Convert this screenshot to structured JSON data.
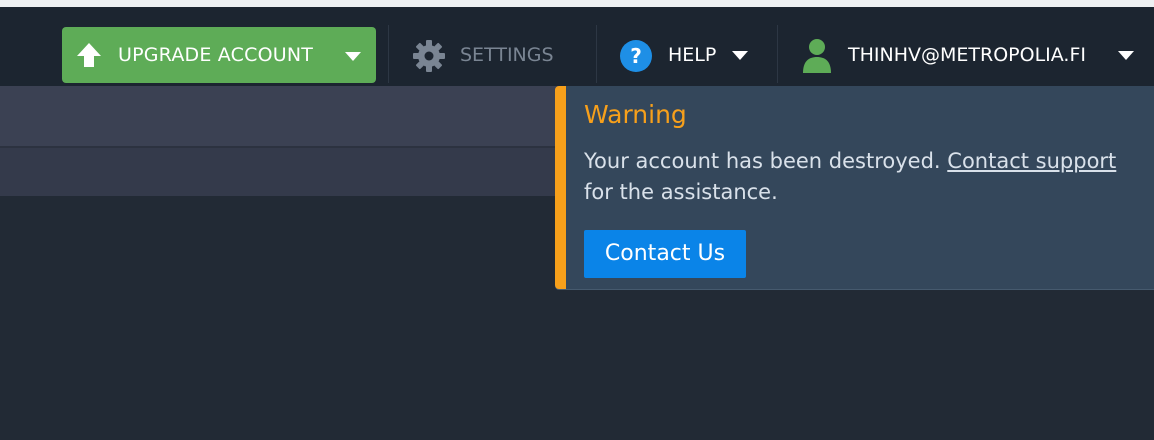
{
  "topbar": {
    "upgrade_label": "UPGRADE ACCOUNT",
    "settings_label": "SETTINGS",
    "help_label": "HELP",
    "help_icon_glyph": "?",
    "user_email": "THINHV@METROPOLIA.FI"
  },
  "popup": {
    "title": "Warning",
    "message_prefix": "Your account has been destroyed.",
    "link_text": "Contact support",
    "message_suffix": "for the assistance.",
    "button_label": "Contact Us"
  },
  "colors": {
    "upgrade_green": "#5eac57",
    "warning_orange": "#f7a01b",
    "popup_bg": "#34475b",
    "button_blue": "#0a84e8",
    "help_blue": "#1e8fe6",
    "user_green": "#5eac57"
  },
  "icons": {
    "upgrade": "arrow-up-icon",
    "settings": "gear-icon",
    "help": "question-icon",
    "user": "user-icon"
  }
}
